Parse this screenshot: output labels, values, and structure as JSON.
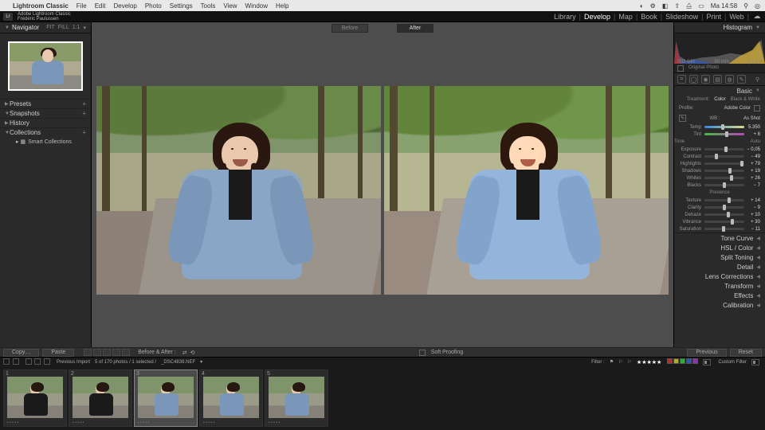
{
  "mac_menu": {
    "app": "Lightroom Classic",
    "items": [
      "File",
      "Edit",
      "Develop",
      "Photo",
      "Settings",
      "Tools",
      "View",
      "Window",
      "Help"
    ],
    "clock": "Ma 14:58"
  },
  "identity": {
    "line1": "Adobe Lightroom Classic",
    "line2": "Frédéric Paulussen",
    "modules": [
      "Library",
      "Develop",
      "Map",
      "Book",
      "Slideshow",
      "Print",
      "Web"
    ],
    "active_module": "Develop"
  },
  "left": {
    "nav_hdr": "Navigator",
    "nav_modes": [
      "FIT",
      "FILL",
      "1:1"
    ],
    "presets": "Presets",
    "snapshots": "Snapshots",
    "history": "History",
    "collections": "Collections",
    "smart": "Smart Collections"
  },
  "compare": {
    "before": "Before",
    "after": "After",
    "ba_label": "Before & After :"
  },
  "toolbar": {
    "copy": "Copy…",
    "paste": "Paste",
    "soft": "Soft Proofing",
    "previous": "Previous",
    "reset": "Reset"
  },
  "right": {
    "histogram": "Histogram",
    "iso": "ISO 640",
    "focal": "50 mm",
    "aperture": "ƒ / 2,0",
    "orig": "Original Photo",
    "basic": "Basic",
    "treatment": "Treatment:",
    "color": "Color",
    "bw": "Black & White",
    "profile_lbl": "Profile:",
    "profile_val": "Adobe Color",
    "wb_lbl": "WB :",
    "wb_val": "As Shot",
    "temp": {
      "lbl": "Temp",
      "val": "5.350"
    },
    "tint": {
      "lbl": "Tint",
      "val": "+ 8"
    },
    "tone_hdr": "Tone",
    "auto": "Auto",
    "exposure": {
      "lbl": "Exposure",
      "val": "− 0,05"
    },
    "contrast": {
      "lbl": "Contrast",
      "val": "− 49"
    },
    "highlights": {
      "lbl": "Highlights",
      "val": "+ 79"
    },
    "shadows": {
      "lbl": "Shadows",
      "val": "+ 19"
    },
    "whites": {
      "lbl": "Whites",
      "val": "+ 26"
    },
    "blacks": {
      "lbl": "Blacks",
      "val": "− 7"
    },
    "presence_hdr": "Presence",
    "texture": {
      "lbl": "Texture",
      "val": "+ 14"
    },
    "clarity": {
      "lbl": "Clarity",
      "val": "− 9"
    },
    "dehaze": {
      "lbl": "Dehaze",
      "val": "+ 10"
    },
    "vibrance": {
      "lbl": "Vibrance",
      "val": "+ 30"
    },
    "saturation": {
      "lbl": "Saturation",
      "val": "− 11"
    },
    "panels": [
      "Tone Curve",
      "HSL / Color",
      "Split Toning",
      "Detail",
      "Lens Corrections",
      "Transform",
      "Effects",
      "Calibration"
    ]
  },
  "infobar": {
    "crumb": "Previous Import",
    "count": "5 of 170 photos / 1 selected /",
    "file": "_DSC4839.NEF",
    "filter_lbl": "Filter :",
    "custom": "Custom Filter"
  },
  "filmstrip": {
    "thumbs": [
      {
        "n": "1",
        "variant": "dark"
      },
      {
        "n": "2",
        "variant": "dark"
      },
      {
        "n": "3",
        "variant": "denim",
        "selected": true
      },
      {
        "n": "4",
        "variant": "denim"
      },
      {
        "n": "5",
        "variant": "denim"
      }
    ]
  }
}
